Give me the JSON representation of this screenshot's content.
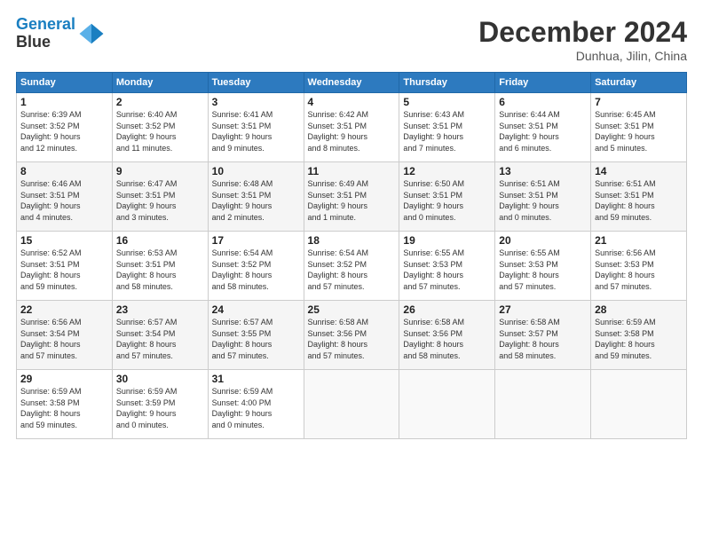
{
  "header": {
    "logo_line1": "General",
    "logo_line2": "Blue",
    "month_title": "December 2024",
    "location": "Dunhua, Jilin, China"
  },
  "weekdays": [
    "Sunday",
    "Monday",
    "Tuesday",
    "Wednesday",
    "Thursday",
    "Friday",
    "Saturday"
  ],
  "weeks": [
    [
      {
        "day": "1",
        "info": "Sunrise: 6:39 AM\nSunset: 3:52 PM\nDaylight: 9 hours\nand 12 minutes."
      },
      {
        "day": "2",
        "info": "Sunrise: 6:40 AM\nSunset: 3:52 PM\nDaylight: 9 hours\nand 11 minutes."
      },
      {
        "day": "3",
        "info": "Sunrise: 6:41 AM\nSunset: 3:51 PM\nDaylight: 9 hours\nand 9 minutes."
      },
      {
        "day": "4",
        "info": "Sunrise: 6:42 AM\nSunset: 3:51 PM\nDaylight: 9 hours\nand 8 minutes."
      },
      {
        "day": "5",
        "info": "Sunrise: 6:43 AM\nSunset: 3:51 PM\nDaylight: 9 hours\nand 7 minutes."
      },
      {
        "day": "6",
        "info": "Sunrise: 6:44 AM\nSunset: 3:51 PM\nDaylight: 9 hours\nand 6 minutes."
      },
      {
        "day": "7",
        "info": "Sunrise: 6:45 AM\nSunset: 3:51 PM\nDaylight: 9 hours\nand 5 minutes."
      }
    ],
    [
      {
        "day": "8",
        "info": "Sunrise: 6:46 AM\nSunset: 3:51 PM\nDaylight: 9 hours\nand 4 minutes."
      },
      {
        "day": "9",
        "info": "Sunrise: 6:47 AM\nSunset: 3:51 PM\nDaylight: 9 hours\nand 3 minutes."
      },
      {
        "day": "10",
        "info": "Sunrise: 6:48 AM\nSunset: 3:51 PM\nDaylight: 9 hours\nand 2 minutes."
      },
      {
        "day": "11",
        "info": "Sunrise: 6:49 AM\nSunset: 3:51 PM\nDaylight: 9 hours\nand 1 minute."
      },
      {
        "day": "12",
        "info": "Sunrise: 6:50 AM\nSunset: 3:51 PM\nDaylight: 9 hours\nand 0 minutes."
      },
      {
        "day": "13",
        "info": "Sunrise: 6:51 AM\nSunset: 3:51 PM\nDaylight: 9 hours\nand 0 minutes."
      },
      {
        "day": "14",
        "info": "Sunrise: 6:51 AM\nSunset: 3:51 PM\nDaylight: 8 hours\nand 59 minutes."
      }
    ],
    [
      {
        "day": "15",
        "info": "Sunrise: 6:52 AM\nSunset: 3:51 PM\nDaylight: 8 hours\nand 59 minutes."
      },
      {
        "day": "16",
        "info": "Sunrise: 6:53 AM\nSunset: 3:51 PM\nDaylight: 8 hours\nand 58 minutes."
      },
      {
        "day": "17",
        "info": "Sunrise: 6:54 AM\nSunset: 3:52 PM\nDaylight: 8 hours\nand 58 minutes."
      },
      {
        "day": "18",
        "info": "Sunrise: 6:54 AM\nSunset: 3:52 PM\nDaylight: 8 hours\nand 57 minutes."
      },
      {
        "day": "19",
        "info": "Sunrise: 6:55 AM\nSunset: 3:53 PM\nDaylight: 8 hours\nand 57 minutes."
      },
      {
        "day": "20",
        "info": "Sunrise: 6:55 AM\nSunset: 3:53 PM\nDaylight: 8 hours\nand 57 minutes."
      },
      {
        "day": "21",
        "info": "Sunrise: 6:56 AM\nSunset: 3:53 PM\nDaylight: 8 hours\nand 57 minutes."
      }
    ],
    [
      {
        "day": "22",
        "info": "Sunrise: 6:56 AM\nSunset: 3:54 PM\nDaylight: 8 hours\nand 57 minutes."
      },
      {
        "day": "23",
        "info": "Sunrise: 6:57 AM\nSunset: 3:54 PM\nDaylight: 8 hours\nand 57 minutes."
      },
      {
        "day": "24",
        "info": "Sunrise: 6:57 AM\nSunset: 3:55 PM\nDaylight: 8 hours\nand 57 minutes."
      },
      {
        "day": "25",
        "info": "Sunrise: 6:58 AM\nSunset: 3:56 PM\nDaylight: 8 hours\nand 57 minutes."
      },
      {
        "day": "26",
        "info": "Sunrise: 6:58 AM\nSunset: 3:56 PM\nDaylight: 8 hours\nand 58 minutes."
      },
      {
        "day": "27",
        "info": "Sunrise: 6:58 AM\nSunset: 3:57 PM\nDaylight: 8 hours\nand 58 minutes."
      },
      {
        "day": "28",
        "info": "Sunrise: 6:59 AM\nSunset: 3:58 PM\nDaylight: 8 hours\nand 59 minutes."
      }
    ],
    [
      {
        "day": "29",
        "info": "Sunrise: 6:59 AM\nSunset: 3:58 PM\nDaylight: 8 hours\nand 59 minutes."
      },
      {
        "day": "30",
        "info": "Sunrise: 6:59 AM\nSunset: 3:59 PM\nDaylight: 9 hours\nand 0 minutes."
      },
      {
        "day": "31",
        "info": "Sunrise: 6:59 AM\nSunset: 4:00 PM\nDaylight: 9 hours\nand 0 minutes."
      },
      null,
      null,
      null,
      null
    ]
  ]
}
